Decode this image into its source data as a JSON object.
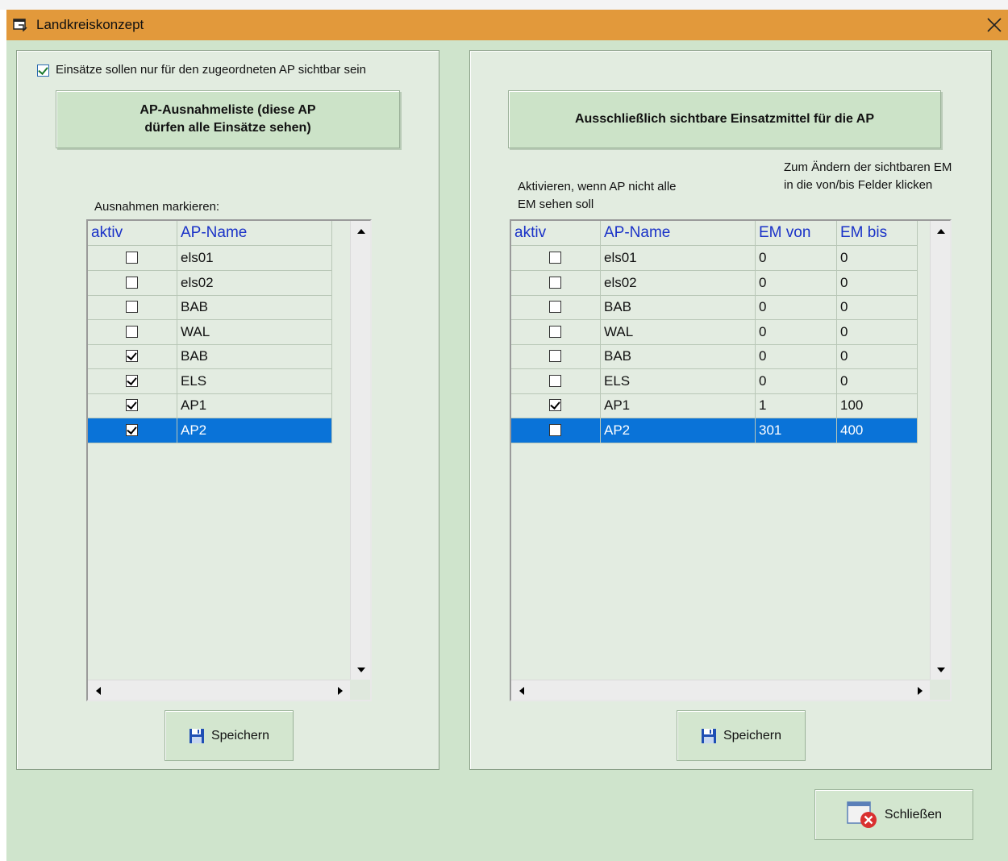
{
  "window": {
    "title": "Landkreiskonzept"
  },
  "left": {
    "only_assigned_label": "Einsätze sollen nur für den zugeordneten AP sichtbar sein",
    "only_assigned_checked": true,
    "header": "AP-Ausnahmeliste (diese AP dürfen alle Einsätze sehen)",
    "mark_label": "Ausnahmen markieren:",
    "columns": [
      "aktiv",
      "AP-Name"
    ],
    "rows": [
      {
        "aktiv": false,
        "name": "els01"
      },
      {
        "aktiv": false,
        "name": "els02"
      },
      {
        "aktiv": false,
        "name": "BAB"
      },
      {
        "aktiv": false,
        "name": "WAL"
      },
      {
        "aktiv": true,
        "name": "BAB"
      },
      {
        "aktiv": true,
        "name": "ELS"
      },
      {
        "aktiv": true,
        "name": "AP1"
      },
      {
        "aktiv": true,
        "name": "AP2"
      }
    ],
    "selected_row": 7,
    "save_label": "Speichern"
  },
  "right": {
    "header": "Ausschließlich sichtbare Einsatzmittel für die AP",
    "activate_label": "Aktivieren, wenn AP nicht alle EM sehen soll",
    "change_label": "Zum Ändern der sichtbaren EM in die von/bis Felder klicken",
    "columns": [
      "aktiv",
      "AP-Name",
      "EM von",
      "EM bis"
    ],
    "rows": [
      {
        "aktiv": false,
        "name": "els01",
        "von": "0",
        "bis": "0"
      },
      {
        "aktiv": false,
        "name": "els02",
        "von": "0",
        "bis": "0"
      },
      {
        "aktiv": false,
        "name": "BAB",
        "von": "0",
        "bis": "0"
      },
      {
        "aktiv": false,
        "name": "WAL",
        "von": "0",
        "bis": "0"
      },
      {
        "aktiv": false,
        "name": "BAB",
        "von": "0",
        "bis": "0"
      },
      {
        "aktiv": false,
        "name": "ELS",
        "von": "0",
        "bis": "0"
      },
      {
        "aktiv": true,
        "name": "AP1",
        "von": "1",
        "bis": "100"
      },
      {
        "aktiv": false,
        "name": "AP2",
        "von": "301",
        "bis": "400"
      }
    ],
    "selected_row": 7,
    "save_label": "Speichern"
  },
  "close_label": "Schließen",
  "colors": {
    "titlebar": "#e2993b",
    "selection": "#0a73d8",
    "header_text": "#1a32c8",
    "background": "#cfe4cc"
  }
}
